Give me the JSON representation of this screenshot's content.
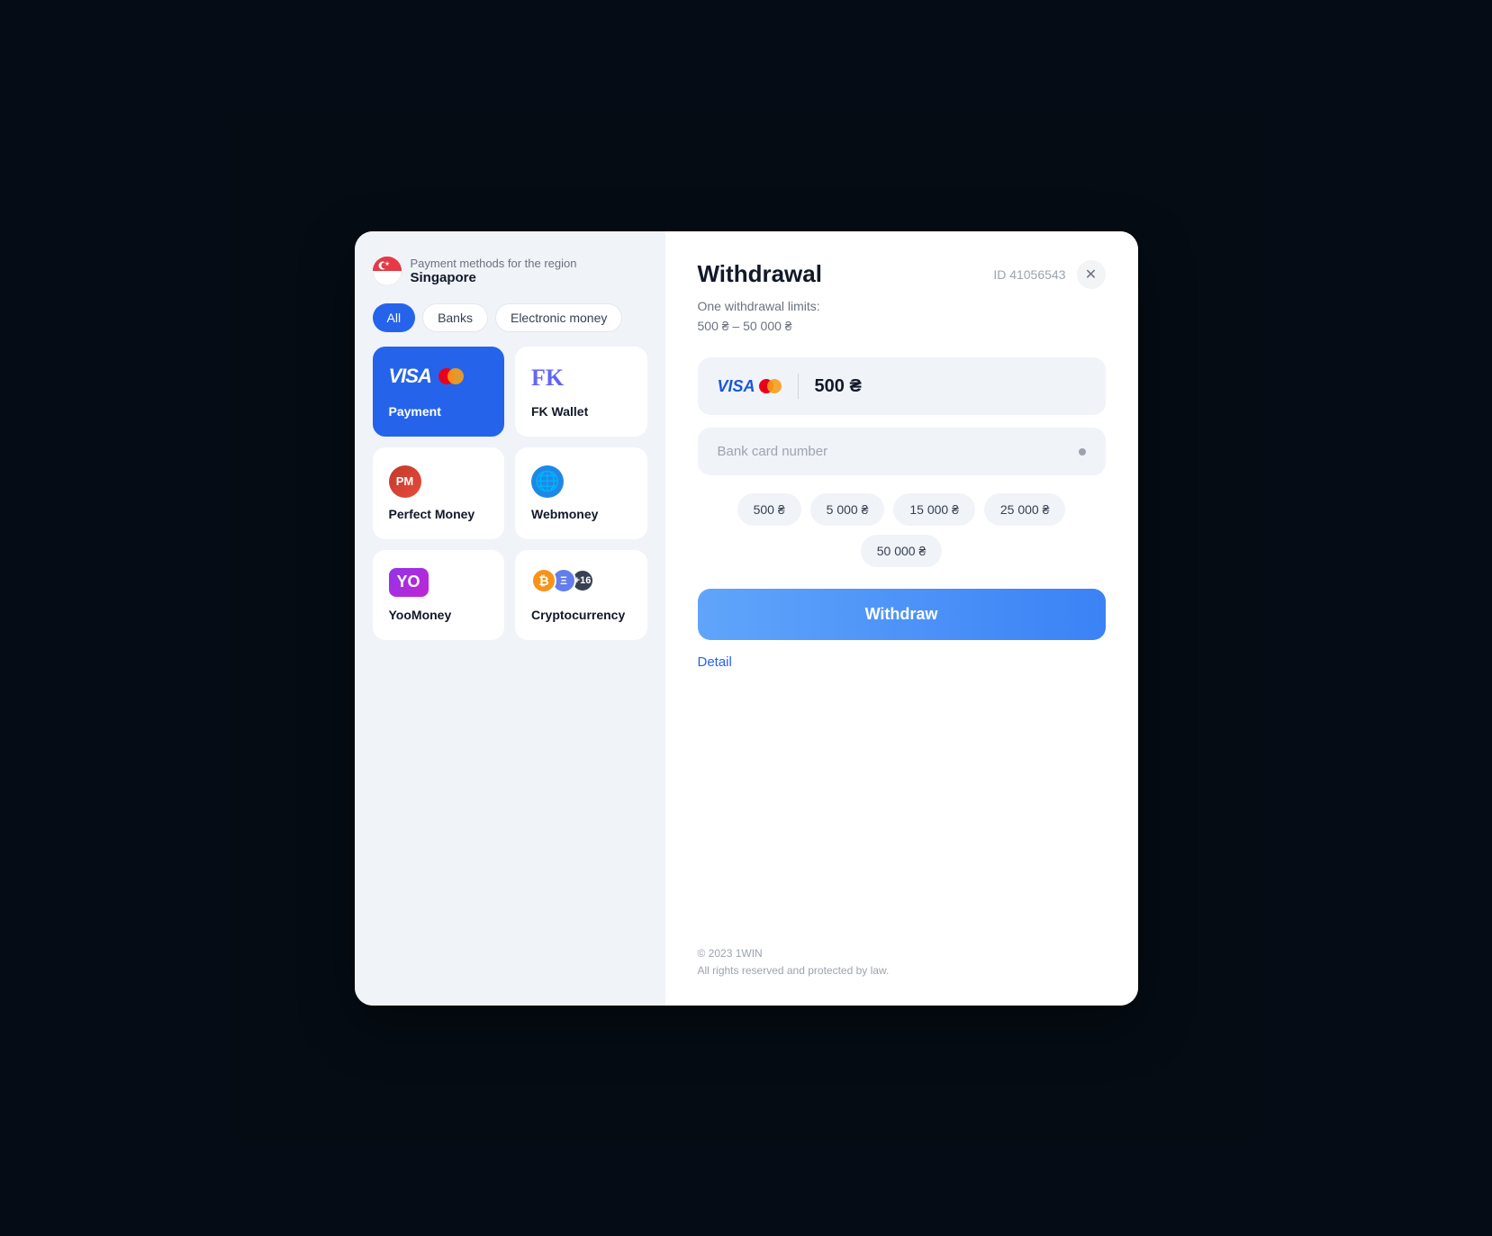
{
  "background": "#0d1b2e",
  "modal": {
    "left": {
      "region_label": "Payment methods for the region",
      "region_name": "Singapore",
      "filters": [
        {
          "id": "all",
          "label": "All",
          "active": true
        },
        {
          "id": "banks",
          "label": "Banks",
          "active": false
        },
        {
          "id": "electronic",
          "label": "Electronic money",
          "active": false
        }
      ],
      "payment_methods": [
        {
          "id": "visa",
          "label": "Payment",
          "type": "visa",
          "selected": true
        },
        {
          "id": "fk-wallet",
          "label": "FK Wallet",
          "type": "fk",
          "selected": false
        },
        {
          "id": "perfect-money",
          "label": "Perfect Money",
          "type": "pm",
          "selected": false
        },
        {
          "id": "webmoney",
          "label": "Webmoney",
          "type": "wm",
          "selected": false
        },
        {
          "id": "yoomoney",
          "label": "YooMoney",
          "type": "yoo",
          "selected": false
        },
        {
          "id": "crypto",
          "label": "Cryptocurrency",
          "type": "crypto",
          "selected": false
        }
      ]
    },
    "right": {
      "title": "Withdrawal",
      "id_label": "ID 41056543",
      "limits_line1": "One withdrawal limits:",
      "limits_line2": "500 ₴ – 50 000 ₴",
      "amount_display": "500 ₴",
      "card_placeholder": "Bank card number",
      "quick_amounts": [
        "500 ₴",
        "5 000 ₴",
        "15 000 ₴",
        "25 000 ₴",
        "50 000 ₴"
      ],
      "withdraw_btn": "Withdraw",
      "detail_link": "Detail",
      "footer_copyright": "© 2023 1WIN",
      "footer_rights": "All rights reserved and protected by law."
    }
  }
}
